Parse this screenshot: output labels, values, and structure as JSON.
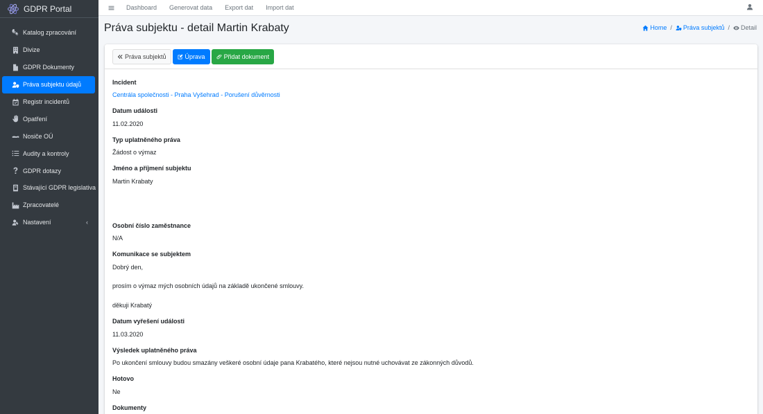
{
  "brand": {
    "name": "GDPR Portal"
  },
  "sidebar": {
    "items": [
      {
        "label": "Katalog zpracování",
        "icon": "cogs-icon"
      },
      {
        "label": "Divize",
        "icon": "building-icon"
      },
      {
        "label": "GDPR Dokumenty",
        "icon": "file-icon"
      },
      {
        "label": "Práva subjektu údajů",
        "icon": "user-shield-icon",
        "active": true
      },
      {
        "label": "Registr incidentů",
        "icon": "calendar-icon"
      },
      {
        "label": "Opatření",
        "icon": "hand-icon"
      },
      {
        "label": "Nosiče OÚ",
        "icon": "hdd-icon"
      },
      {
        "label": "Audity a kontroly",
        "icon": "list-icon"
      },
      {
        "label": "GDPR dotazy",
        "icon": "question-icon"
      },
      {
        "label": "Stávající GDPR legislativa",
        "icon": "book-icon"
      },
      {
        "label": "Zpracovatelé",
        "icon": "industry-icon"
      },
      {
        "label": "Nastavení",
        "icon": "user-cog-icon"
      }
    ]
  },
  "topnav": {
    "links": [
      "Dashboard",
      "Generovat data",
      "Export dat",
      "Import dat"
    ]
  },
  "page": {
    "title": "Práva subjektu - detail Martin Krabaty"
  },
  "breadcrumb": {
    "home": "Home",
    "section": "Práva subjektů",
    "current": "Detail"
  },
  "toolbar": {
    "back": "Práva subjektů",
    "edit": "Úprava",
    "add_document": "Přidat dokument"
  },
  "detail": {
    "incident_label": "Incident",
    "incident_value": "Centrála společnosti - Praha Vyšehrad - Porušení důvěrnosti",
    "event_date_label": "Datum události",
    "event_date_value": "11.02.2020",
    "right_type_label": "Typ uplatněného práva",
    "right_type_value": "Žádost o výmaz",
    "subject_name_label": "Jméno a příjmení subjektu",
    "subject_name_value": "Martin Krabaty",
    "employee_no_label": "Osobní číslo zaměstnance",
    "employee_no_value": "N/A",
    "communication_label": "Komunikace se subjektem",
    "communication_line1": "Dobrý den,",
    "communication_line2": "prosím o výmaz mých osobních údajů na základě ukončené smlouvy.",
    "communication_line3": "děkuji Krabatý",
    "resolution_date_label": "Datum vyřešení události",
    "resolution_date_value": "11.03.2020",
    "result_label": "Výsledek uplatněného práva",
    "result_value": "Po ukončení smlouvy budou smazány veškeré osobní údaje pana Krabatého, které nejsou nutné uchovávat ze zákonných důvodů.",
    "done_label": "Hotovo",
    "done_value": "Ne",
    "documents_label": "Dokumenty"
  },
  "colors": {
    "sidebar": "#343a40",
    "primary": "#007bff",
    "success": "#28a745"
  }
}
